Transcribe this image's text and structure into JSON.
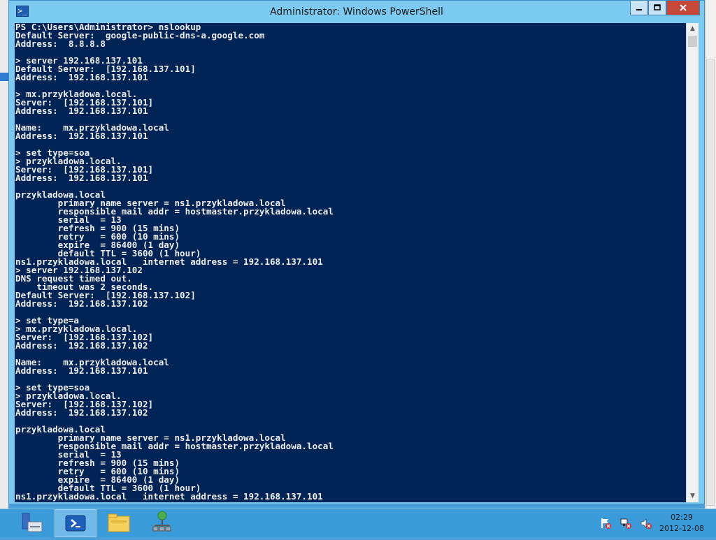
{
  "window": {
    "title": "Administrator: Windows PowerShell"
  },
  "console": {
    "lines": [
      "PS C:\\Users\\Administrator> nslookup",
      "Default Server:  google-public-dns-a.google.com",
      "Address:  8.8.8.8",
      "",
      "> server 192.168.137.101",
      "Default Server:  [192.168.137.101]",
      "Address:  192.168.137.101",
      "",
      "> mx.przykladowa.local.",
      "Server:  [192.168.137.101]",
      "Address:  192.168.137.101",
      "",
      "Name:    mx.przykladowa.local",
      "Address:  192.168.137.101",
      "",
      "> set type=soa",
      "> przykladowa.local.",
      "Server:  [192.168.137.101]",
      "Address:  192.168.137.101",
      "",
      "przykladowa.local",
      "        primary name server = ns1.przykladowa.local",
      "        responsible mail addr = hostmaster.przykladowa.local",
      "        serial  = 13",
      "        refresh = 900 (15 mins)",
      "        retry   = 600 (10 mins)",
      "        expire  = 86400 (1 day)",
      "        default TTL = 3600 (1 hour)",
      "ns1.przykladowa.local   internet address = 192.168.137.101",
      "> server 192.168.137.102",
      "DNS request timed out.",
      "    timeout was 2 seconds.",
      "Default Server:  [192.168.137.102]",
      "Address:  192.168.137.102",
      "",
      "> set type=a",
      "> mx.przykladowa.local.",
      "Server:  [192.168.137.102]",
      "Address:  192.168.137.102",
      "",
      "Name:    mx.przykladowa.local",
      "Address:  192.168.137.101",
      "",
      "> set type=soa",
      "> przykladowa.local.",
      "Server:  [192.168.137.102]",
      "Address:  192.168.137.102",
      "",
      "przykladowa.local",
      "        primary name server = ns1.przykladowa.local",
      "        responsible mail addr = hostmaster.przykladowa.local",
      "        serial  = 13",
      "        refresh = 900 (15 mins)",
      "        retry   = 600 (10 mins)",
      "        expire  = 86400 (1 day)",
      "        default TTL = 3600 (1 hour)",
      "ns1.przykladowa.local   internet address = 192.168.137.101"
    ]
  },
  "taskbar": {
    "buttons": [
      {
        "icon": "server-manager-icon"
      },
      {
        "icon": "powershell-icon",
        "active": true
      },
      {
        "icon": "file-explorer-icon"
      },
      {
        "icon": "network-icon"
      }
    ],
    "tray_icons": [
      "action-center-flag-icon",
      "network-status-icon",
      "volume-muted-icon"
    ],
    "clock": {
      "time": "02:29",
      "date": "2012-12-08"
    }
  },
  "colors": {
    "console_bg": "#012456",
    "console_fg": "#eeedf0",
    "titlebar": "#7ccaf0",
    "close_button": "#c7473a",
    "taskbar": "#3b9ad8"
  }
}
